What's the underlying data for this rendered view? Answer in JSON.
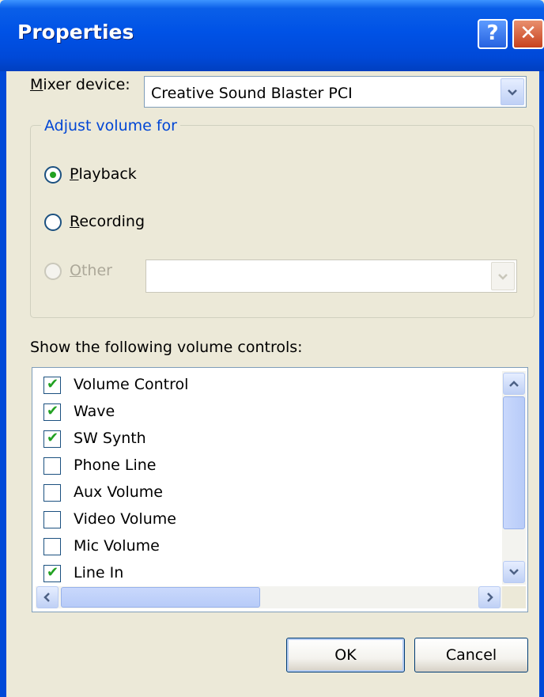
{
  "window": {
    "title": "Properties",
    "help_icon_glyph": "?",
    "close_icon_glyph": "✕"
  },
  "mixer": {
    "label": "Mixer device:",
    "label_access_key": "M",
    "label_rest": "ixer device:",
    "value": "Creative Sound Blaster PCI"
  },
  "adjust": {
    "title": "Adjust volume for",
    "options": [
      {
        "label": "Playback",
        "key": "P",
        "rest": "layback",
        "checked": true,
        "enabled": true
      },
      {
        "label": "Recording",
        "key": "R",
        "rest": "ecording",
        "checked": false,
        "enabled": true
      },
      {
        "label": "Other",
        "key": "O",
        "rest": "ther",
        "checked": false,
        "enabled": false
      }
    ],
    "other_combo_value": ""
  },
  "controls": {
    "heading": "Show the following volume controls:",
    "items": [
      {
        "label": "Volume Control",
        "checked": true
      },
      {
        "label": "Wave",
        "checked": true
      },
      {
        "label": "SW Synth",
        "checked": true
      },
      {
        "label": "Phone Line",
        "checked": false
      },
      {
        "label": "Aux Volume",
        "checked": false
      },
      {
        "label": "Video Volume",
        "checked": false
      },
      {
        "label": "Mic Volume",
        "checked": false
      },
      {
        "label": "Line In",
        "checked": true
      }
    ],
    "check_glyph": "✔"
  },
  "buttons": {
    "ok": "OK",
    "cancel": "Cancel"
  },
  "colors": {
    "title_bar": "#0052e6",
    "group_title": "#0046d5",
    "check": "#21a121"
  }
}
